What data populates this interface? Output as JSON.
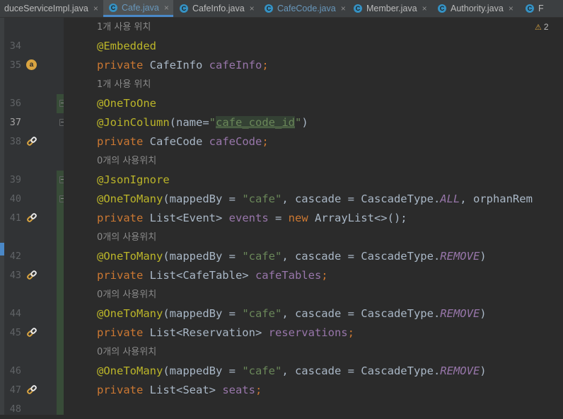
{
  "tabs": [
    {
      "label": "duceServiceImpl.java",
      "active": false,
      "icon": false
    },
    {
      "label": "Cafe.java",
      "active": true,
      "icon": "class-icon"
    },
    {
      "label": "CafeInfo.java",
      "active": false,
      "icon": "class-icon"
    },
    {
      "label": "CafeCode.java",
      "active": false,
      "icon": "class-icon"
    },
    {
      "label": "Member.java",
      "active": false,
      "icon": "class-icon"
    },
    {
      "label": "Authority.java",
      "active": false,
      "icon": "class-icon"
    },
    {
      "label": "F",
      "active": false,
      "icon": "class-icon"
    }
  ],
  "tab_icon_letter": "C",
  "close_glyph": "×",
  "warnings": {
    "glyph": "⚠",
    "count": "2"
  },
  "gutter_badge_letter": "a",
  "usage_hints": {
    "one_usage": "1개 사용 위치",
    "zero_usage": "0개의 사용위치"
  },
  "line_numbers": [
    "34",
    "35",
    "36",
    "37",
    "38",
    "39",
    "40",
    "41",
    "42",
    "43",
    "44",
    "45",
    "46",
    "47",
    "48"
  ],
  "current_line": "37",
  "code": {
    "l34": {
      "ann": "@Embedded"
    },
    "l35": {
      "kw": "private",
      "type": " CafeInfo ",
      "name": "cafeInfo",
      "end": ";"
    },
    "l36": {
      "ann": "@OneToOne"
    },
    "l37": {
      "ann": "@JoinColumn",
      "pre": "(name=",
      "q1": "\"",
      "str": "cafe_code_id",
      "q2": "\"",
      "post": ")"
    },
    "l38": {
      "kw": "private",
      "type": " CafeCode ",
      "name": "cafeCode",
      "end": ";"
    },
    "l39": {
      "ann": "@JsonIgnore"
    },
    "l40": {
      "ann": "@OneToMany",
      "pre": "(mappedBy = ",
      "str": "\"cafe\"",
      "mid": ", cascade = CascadeType.",
      "const": "ALL",
      "post": ", orphanRem"
    },
    "l41": {
      "kw": "private",
      "type": " List<Event> ",
      "name": "events",
      "mid": " = ",
      "kw2": "new",
      "post": " ArrayList<>();"
    },
    "l42": {
      "ann": "@OneToMany",
      "pre": "(mappedBy = ",
      "str": "\"cafe\"",
      "mid": ", cascade = CascadeType.",
      "const": "REMOVE",
      "post": ")"
    },
    "l43": {
      "kw": "private",
      "type": " List<CafeTable> ",
      "name": "cafeTables",
      "end": ";"
    },
    "l44": {
      "ann": "@OneToMany",
      "pre": "(mappedBy = ",
      "str": "\"cafe\"",
      "mid": ", cascade = CascadeType.",
      "const": "REMOVE",
      "post": ")"
    },
    "l45": {
      "kw": "private",
      "type": " List<Reservation> ",
      "name": "reservations",
      "end": ";"
    },
    "l46": {
      "ann": "@OneToMany",
      "pre": "(mappedBy = ",
      "str": "\"cafe\"",
      "mid": ", cascade = CascadeType.",
      "const": "REMOVE",
      "post": ")"
    },
    "l47": {
      "kw": "private",
      "type": " List<Seat> ",
      "name": "seats",
      "end": ";"
    }
  },
  "colors": {
    "background": "#2b2b2b",
    "keyword": "#cc7832",
    "annotation": "#bbb529",
    "string": "#6a8759",
    "field": "#9876aa",
    "text": "#a9b7c6"
  }
}
